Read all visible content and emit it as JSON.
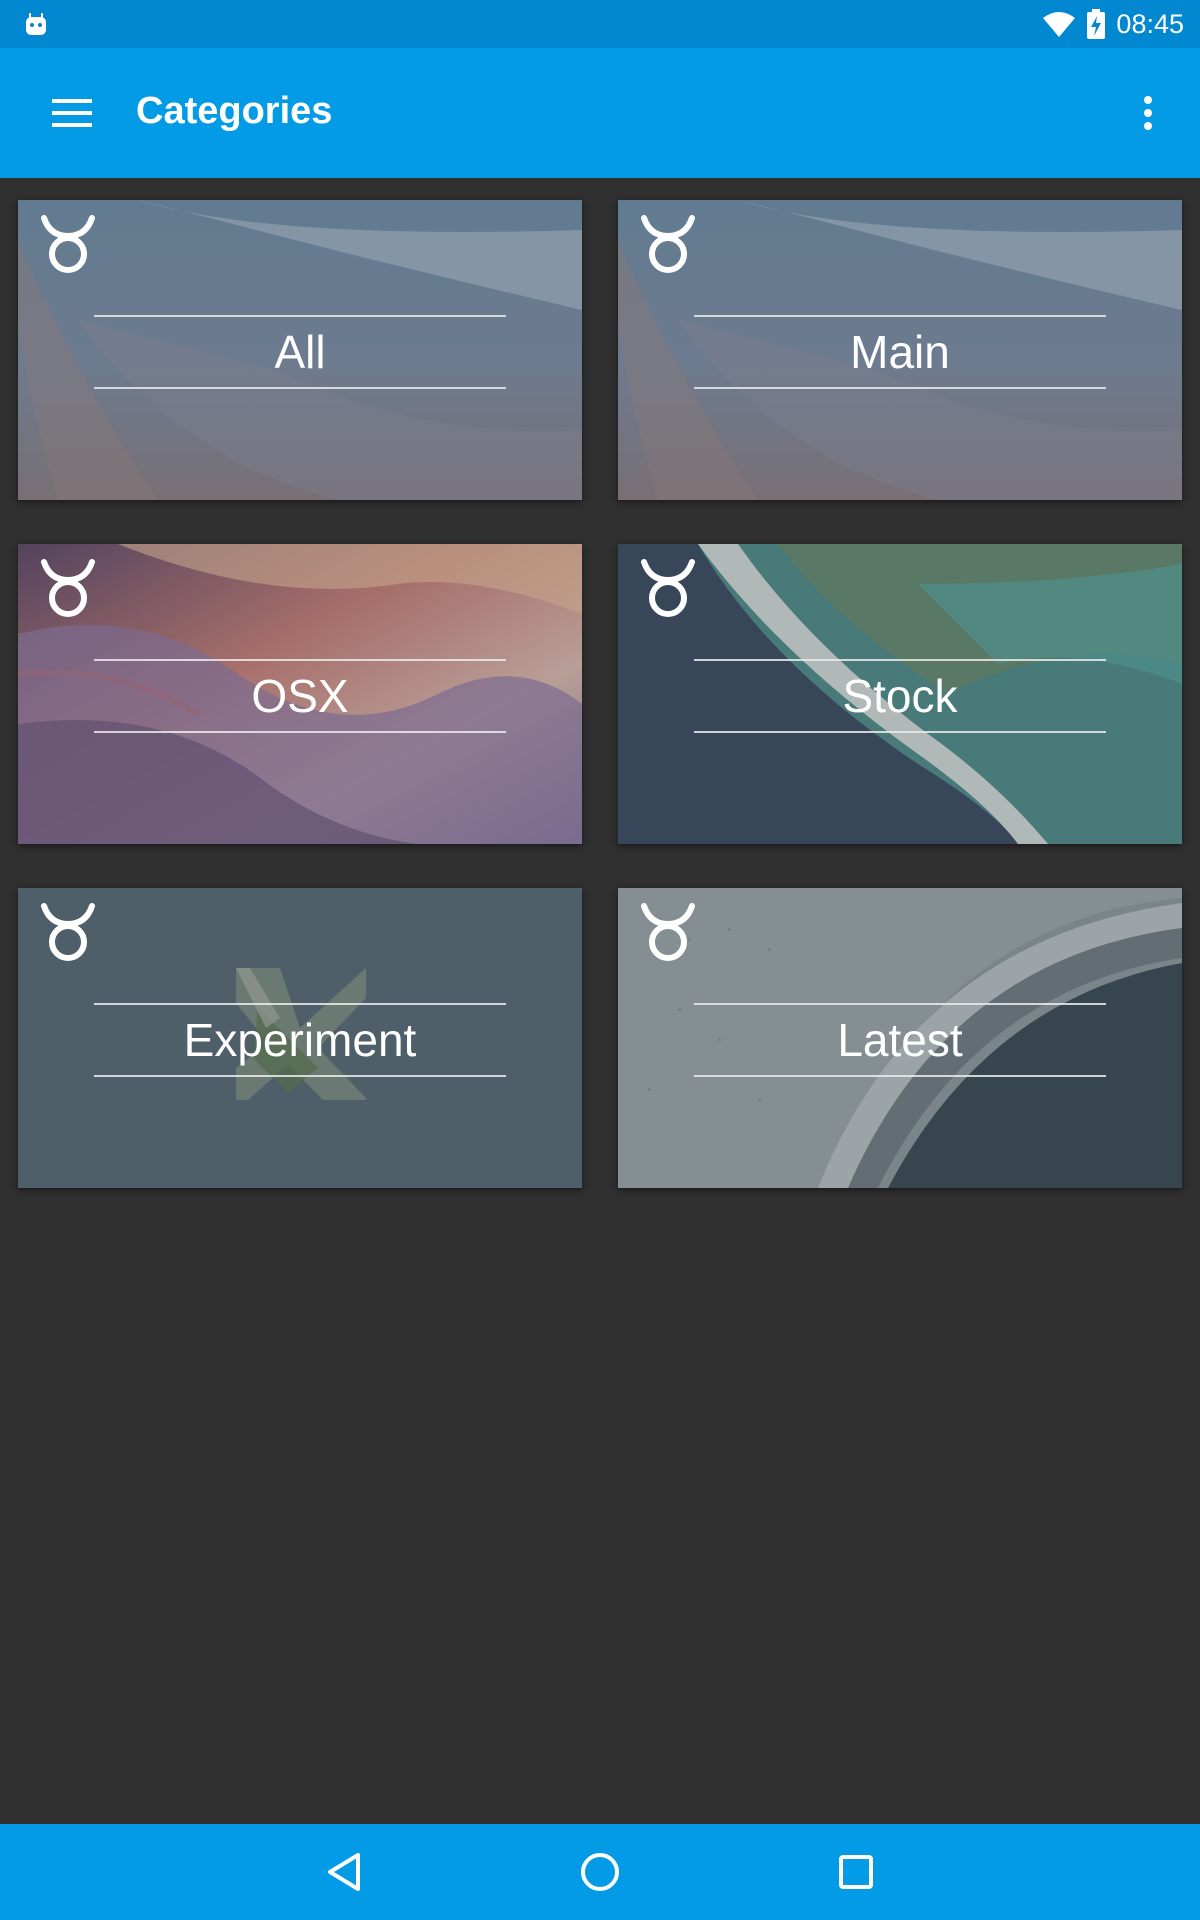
{
  "status_bar": {
    "time": "08:45",
    "left_icon": "android-debug-icon",
    "wifi_icon": "wifi-icon",
    "battery_icon": "battery-charging-icon"
  },
  "app_bar": {
    "title": "Categories",
    "menu_icon": "hamburger-menu-icon",
    "overflow_icon": "more-vert-icon"
  },
  "categories": [
    {
      "label": "All"
    },
    {
      "label": "Main"
    },
    {
      "label": "OSX"
    },
    {
      "label": "Stock"
    },
    {
      "label": "Experiment"
    },
    {
      "label": "Latest"
    }
  ],
  "nav_bar": {
    "back_icon": "back-triangle-icon",
    "home_icon": "home-circle-icon",
    "recents_icon": "recents-square-icon"
  },
  "colors": {
    "status_bar": "#0288d1",
    "app_bar": "#039be5",
    "background": "#303030"
  }
}
